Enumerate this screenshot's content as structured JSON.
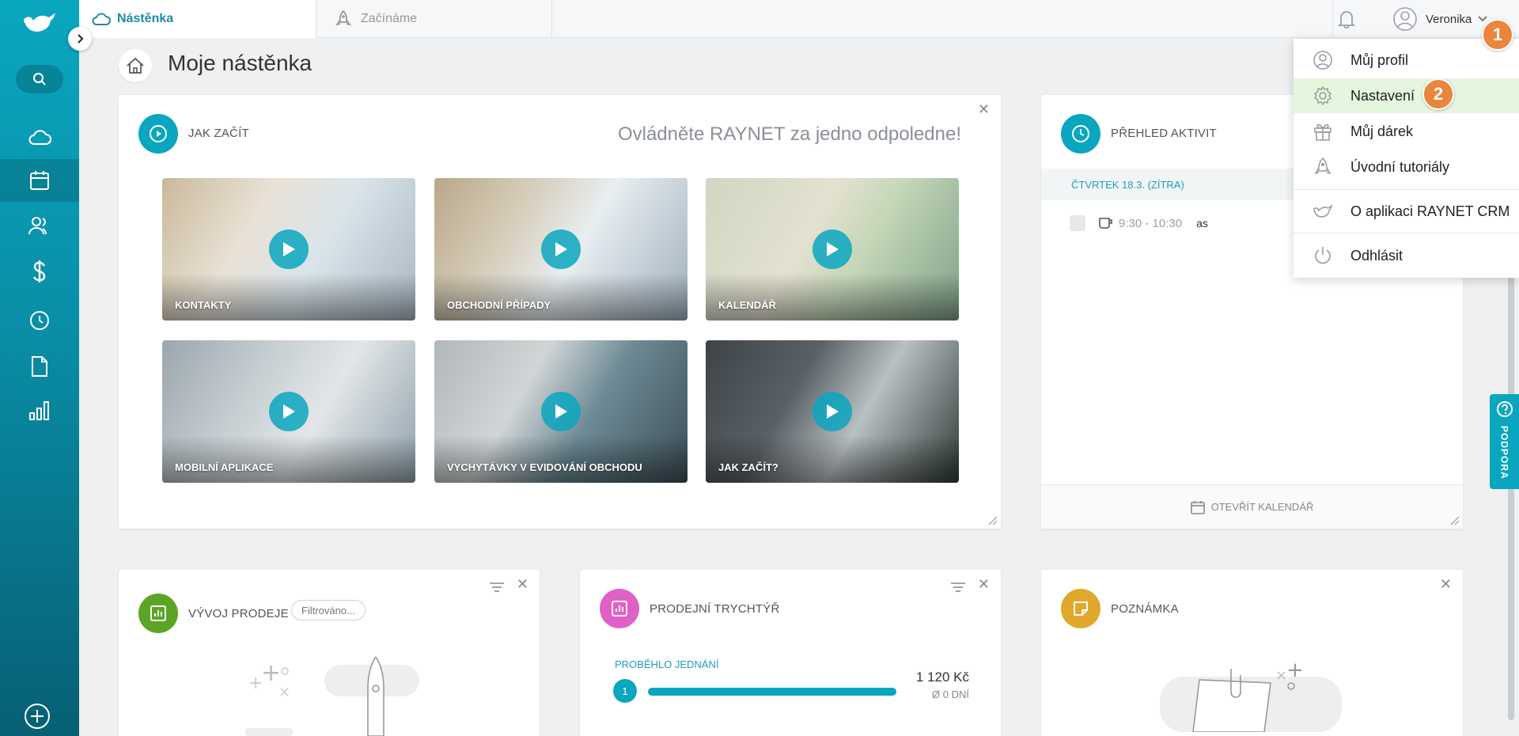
{
  "topbar": {
    "tabs": [
      {
        "label": "Nástěnka",
        "icon": "cloud-icon",
        "active": true
      },
      {
        "label": "Začínáme",
        "icon": "rocket-icon",
        "active": false
      }
    ],
    "user_name": "Veronika"
  },
  "page": {
    "title": "Moje nástěnka"
  },
  "getting_started": {
    "title": "JAK ZAČÍT",
    "tagline": "Ovládněte RAYNET za jedno odpoledne!",
    "videos": [
      {
        "label": "KONTAKTY"
      },
      {
        "label": "OBCHODNÍ PŘÍPADY"
      },
      {
        "label": "KALENDÁŘ"
      },
      {
        "label": "MOBILNÍ APLIKACE"
      },
      {
        "label": "VYCHYTÁVKY V EVIDOVÁNÍ OBCHODU"
      },
      {
        "label": "JAK ZAČÍT?"
      }
    ]
  },
  "activities": {
    "title": "PŘEHLED AKTIVIT",
    "day": "ČTVRTEK 18.3. (ZÍTRA)",
    "items": [
      {
        "time": "9:30 - 10:30",
        "title": "as"
      }
    ],
    "footer": "OTEVŘÍT KALENDÁŘ"
  },
  "sales": {
    "title": "VÝVOJ PRODEJE",
    "filter": "Filtrováno..."
  },
  "funnel": {
    "title": "PRODEJNÍ TRYCHTÝŘ",
    "stage": "PROBĚHLO JEDNÁNÍ",
    "count": "1",
    "amount": "1 120 Kč",
    "days": "Ø 0 DNÍ"
  },
  "note": {
    "title": "POZNÁMKA"
  },
  "user_menu": {
    "items": [
      {
        "label": "Můj profil",
        "icon": "user-circle-icon"
      },
      {
        "label": "Nastavení",
        "icon": "gear-icon"
      },
      {
        "label": "Můj dárek",
        "icon": "gift-icon"
      },
      {
        "label": "Úvodní tutoriály",
        "icon": "rocket-icon"
      },
      {
        "label": "O aplikaci RAYNET CRM",
        "icon": "raynet-logo-icon"
      },
      {
        "label": "Odhlásit",
        "icon": "power-icon"
      }
    ]
  },
  "steps": [
    "1",
    "2"
  ],
  "support": {
    "label": "PODPORA"
  },
  "colors": {
    "accent": "#0aa6c0",
    "sales_icon": "#5aa624",
    "funnel_icon": "#e060c8",
    "note_icon": "#e0a82c",
    "step_badge": "#e9853c",
    "highlight": "#e5f6de"
  }
}
